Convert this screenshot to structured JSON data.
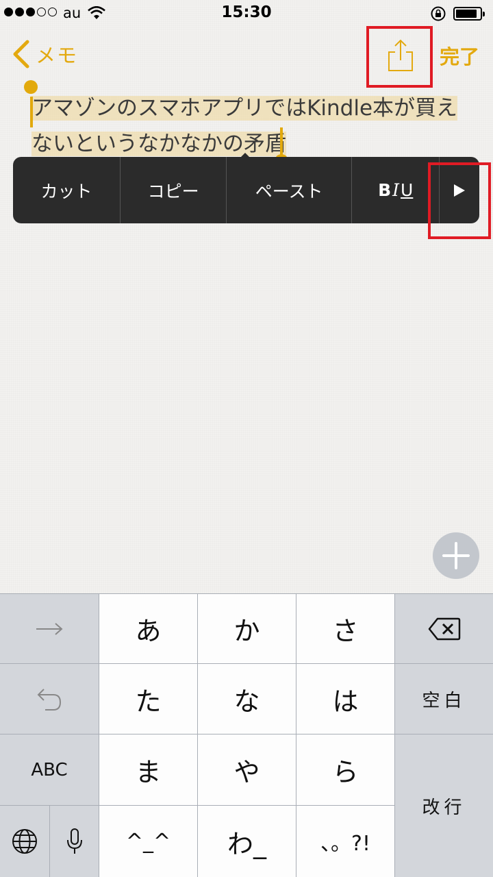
{
  "status_bar": {
    "carrier": "au",
    "time": "15:30"
  },
  "nav": {
    "back_label": "メモ",
    "done_label": "完了"
  },
  "note": {
    "line1": "アマゾンのスマホアプリではKindle本が買え",
    "line2": "ないというなかなかの矛盾"
  },
  "edit_menu": {
    "cut": "カット",
    "copy": "コピー",
    "paste": "ペースト",
    "bold": "B",
    "italic": "I",
    "underline": "U"
  },
  "keyboard": {
    "row1": [
      "あ",
      "か",
      "さ"
    ],
    "row2": [
      "た",
      "な",
      "は"
    ],
    "row3": [
      "ま",
      "や",
      "ら"
    ],
    "row4": [
      "^_^",
      "わ_",
      "、。?!"
    ],
    "space": "空白",
    "abc": "ABC",
    "return": "改行"
  },
  "colors": {
    "accent": "#e3a90f",
    "highlight_box": "#e01b24"
  }
}
